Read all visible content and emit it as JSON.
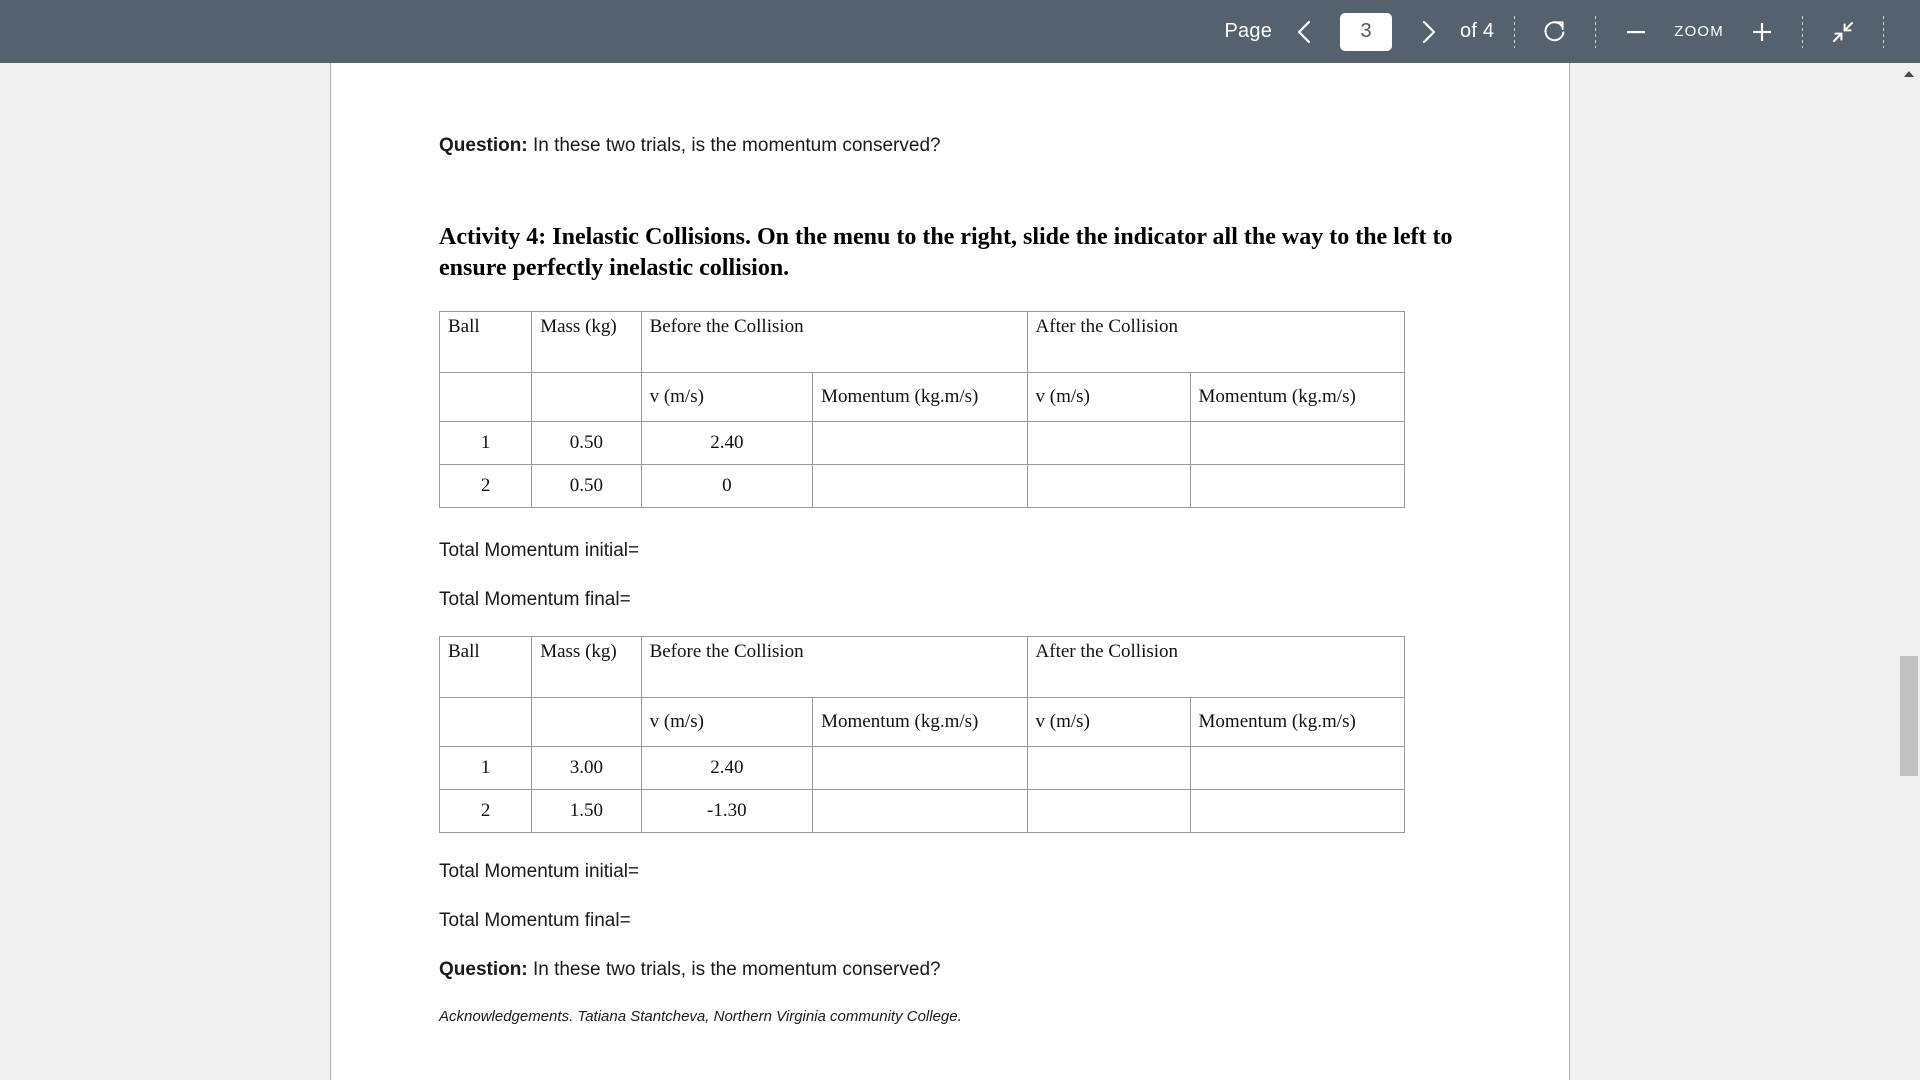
{
  "toolbar": {
    "page_label": "Page",
    "page_value": "3",
    "page_total": "of 4",
    "zoom_label": "ZOOM",
    "prev_icon": "chevron-left-icon",
    "next_icon": "chevron-right-icon",
    "rotate_icon": "rotate-icon",
    "zoom_out_icon": "minus-icon",
    "zoom_in_icon": "plus-icon",
    "fit_icon": "collapse-fullscreen-icon",
    "background_color": "#54616f"
  },
  "document": {
    "question_top": {
      "prefix": "Question:",
      "text": " In these two trials, is the momentum conserved?"
    },
    "activity_heading": "Activity 4: Inelastic Collisions. On the menu to the right, slide the indicator all the way to the left to ensure perfectly inelastic collision.",
    "totals_first": {
      "initial": "Total Momentum initial=",
      "final": "Total Momentum final="
    },
    "totals_second": {
      "initial": "Total Momentum initial=",
      "final": "Total Momentum final="
    },
    "question_bottom": {
      "prefix": "Question:",
      "text": " In these two trials, is the momentum conserved?"
    },
    "acknowledgement": "Acknowledgements. Tatiana Stantcheva, Northern Virginia community College."
  },
  "tables": [
    {
      "headers_row1": [
        "Ball",
        "Mass (kg)",
        "Before the Collision",
        "After the Collision"
      ],
      "headers_row2": [
        "",
        "",
        "v (m/s)",
        "Momentum (kg.m/s)",
        "v (m/s)",
        "Momentum (kg.m/s)"
      ],
      "rows": [
        {
          "ball": "1",
          "mass": "0.50",
          "v_before": "2.40",
          "momentum_before": "",
          "v_after": "",
          "momentum_after": ""
        },
        {
          "ball": "2",
          "mass": "0.50",
          "v_before": "0",
          "momentum_before": "",
          "v_after": "",
          "momentum_after": ""
        }
      ]
    },
    {
      "headers_row1": [
        "Ball",
        "Mass (kg)",
        "Before the Collision",
        "After the Collision"
      ],
      "headers_row2": [
        "",
        "",
        "v (m/s)",
        "Momentum (kg.m/s)",
        "v (m/s)",
        "Momentum (kg.m/s)"
      ],
      "rows": [
        {
          "ball": "1",
          "mass": "3.00",
          "v_before": "2.40",
          "momentum_before": "",
          "v_after": "",
          "momentum_after": ""
        },
        {
          "ball": "2",
          "mass": "1.50",
          "v_before": "-1.30",
          "momentum_before": "",
          "v_after": "",
          "momentum_after": ""
        }
      ]
    }
  ],
  "scrollbar": {
    "up_arrow_icon": "triangle-up-icon",
    "track_color": "#f0f0f0",
    "thumb_color": "#c1c1c1"
  }
}
